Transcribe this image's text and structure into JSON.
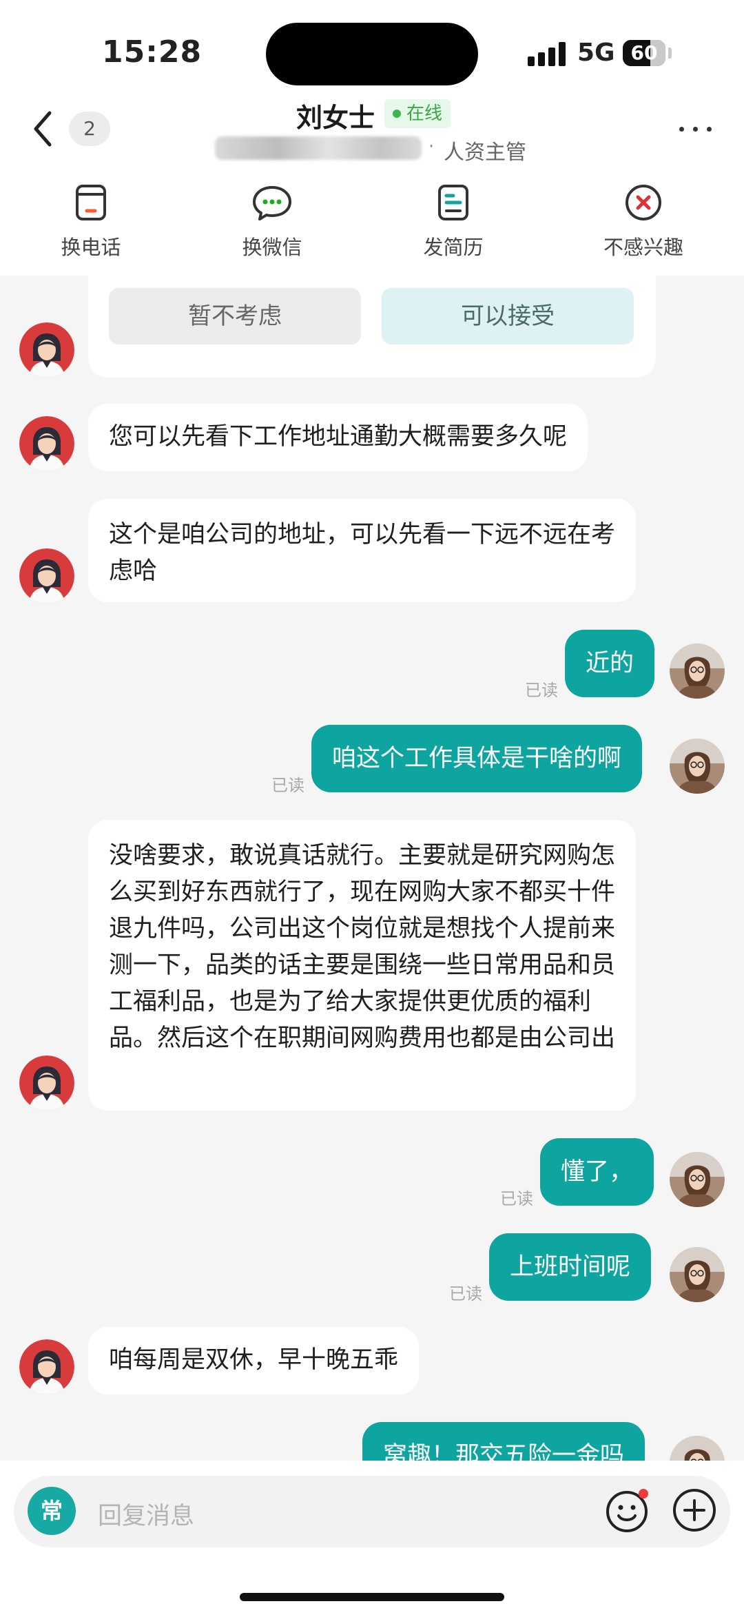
{
  "status": {
    "time": "15:28",
    "network": "5G",
    "battery": "60",
    "battery_level_percent": 60
  },
  "header": {
    "unread_count": "2",
    "contact_name": "刘女士",
    "online_label": "在线",
    "separator": "·",
    "role": "人资主管"
  },
  "actions": [
    {
      "label": "换电话",
      "icon": "phone-card-icon"
    },
    {
      "label": "换微信",
      "icon": "wechat-icon"
    },
    {
      "label": "发简历",
      "icon": "resume-icon"
    },
    {
      "label": "不感兴趣",
      "icon": "not-interested-icon"
    }
  ],
  "options": {
    "decline": "暂不考虑",
    "accept": "可以接受"
  },
  "messages": [
    {
      "side": "in",
      "text": "您可以先看下工作地址通勤大概需要多久呢"
    },
    {
      "side": "in",
      "text": "这个是咱公司的地址，可以先看一下远不远在考虑哈"
    },
    {
      "side": "out",
      "text": "近的",
      "status": "已读"
    },
    {
      "side": "out",
      "text": "咱这个工作具体是干啥的啊",
      "status": "已读"
    },
    {
      "side": "in",
      "text": "没啥要求，敢说真话就行。主要就是研究网购怎么买到好东西就行了，现在网购大家不都买十件退九件吗，公司出这个岗位就是想找个人提前来测一下，品类的话主要是围绕一些日常用品和员工福利品，也是为了给大家提供更优质的福利品。然后这个在职期间网购费用也都是由公司出"
    },
    {
      "side": "out",
      "text": "懂了，",
      "status": "已读"
    },
    {
      "side": "out",
      "text": "上班时间呢",
      "status": "已读"
    },
    {
      "side": "in",
      "text": "咱每周是双休，早十晚五乖"
    },
    {
      "side": "out",
      "text": "窝趣！那交五险一金吗"
    }
  ],
  "input": {
    "quick_label": "常",
    "placeholder": "回复消息"
  },
  "colors": {
    "accent": "#0ea5a0",
    "online": "#39b54a",
    "decline_red": "#e0303a"
  }
}
